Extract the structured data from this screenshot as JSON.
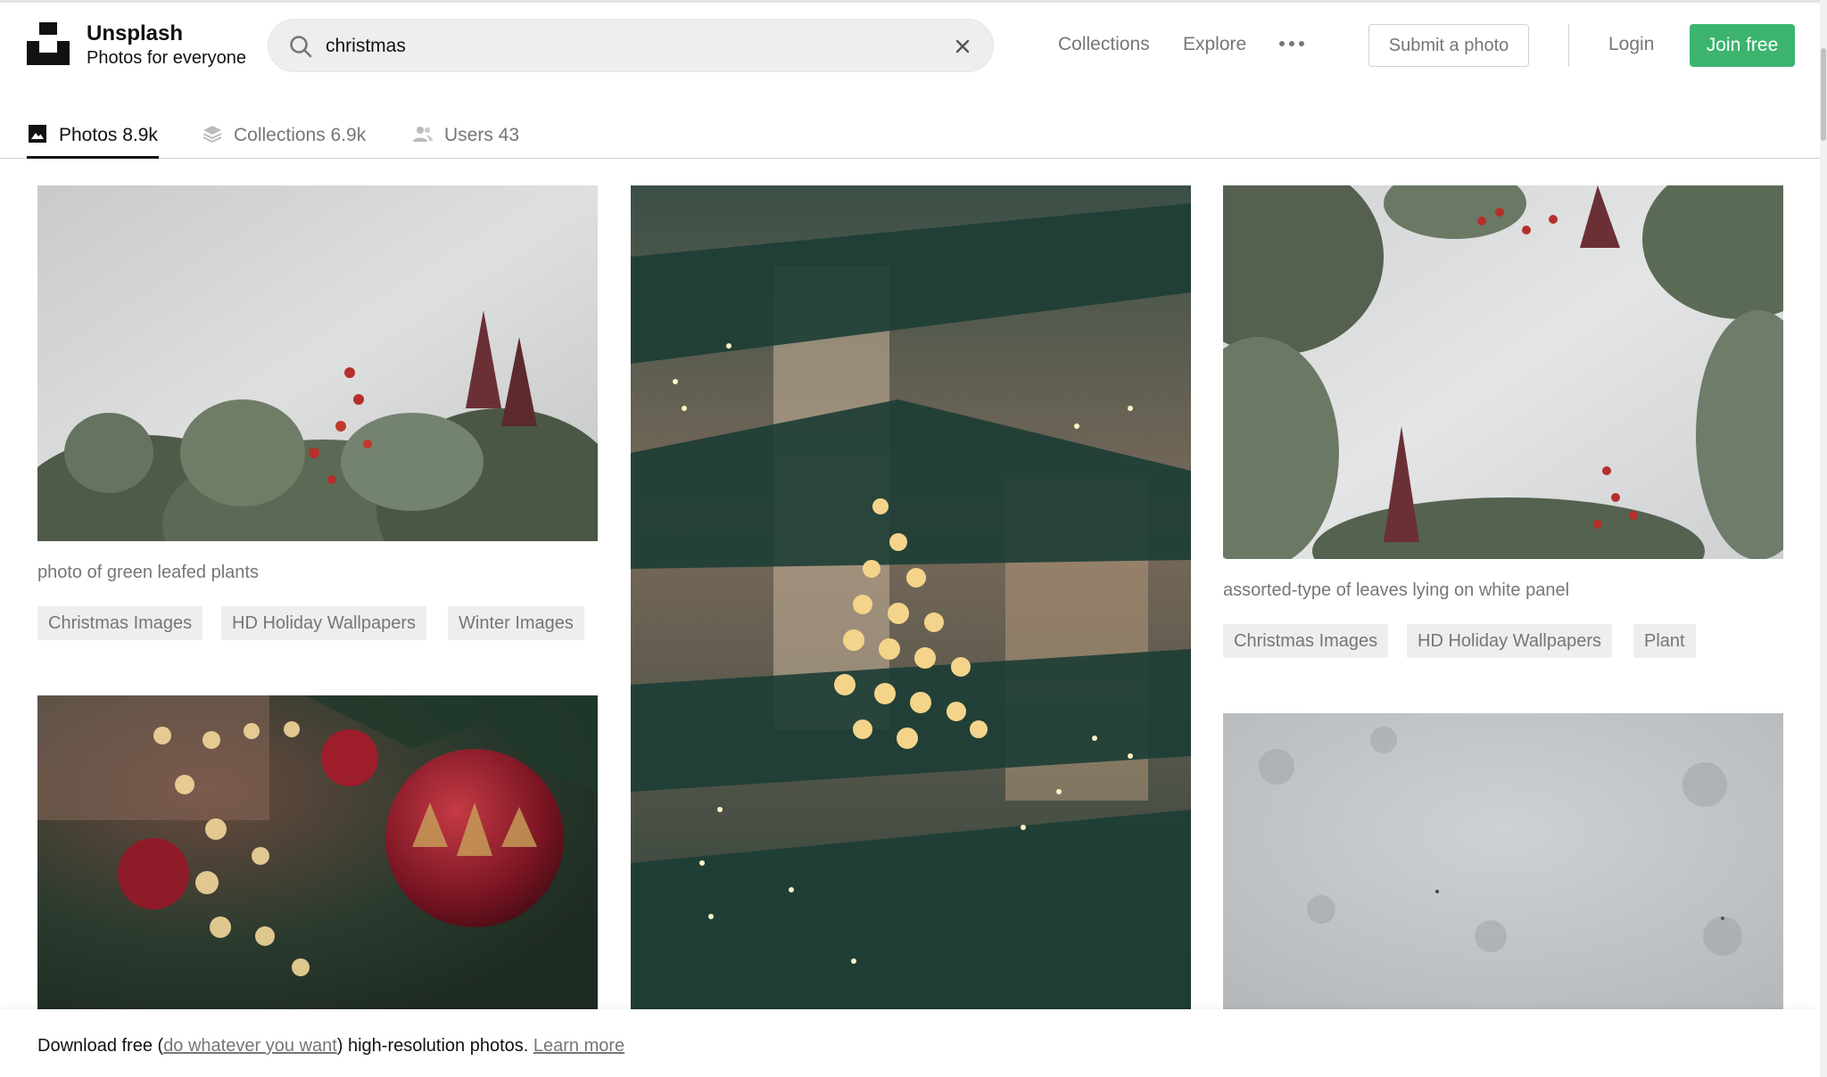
{
  "brand": {
    "name": "Unsplash",
    "tagline": "Photos for everyone"
  },
  "search": {
    "value": "christmas",
    "placeholder": "Search free high-resolution photos",
    "icon": "search-icon",
    "clear_icon": "close-icon"
  },
  "nav": {
    "collections": "Collections",
    "explore": "Explore",
    "more_icon": "more-horizontal-icon",
    "submit": "Submit a photo",
    "login": "Login",
    "join": "Join free"
  },
  "tabs": [
    {
      "label": "Photos 8.9k",
      "icon": "image-icon",
      "active": true
    },
    {
      "label": "Collections 6.9k",
      "icon": "layers-icon",
      "active": false
    },
    {
      "label": "Users 43",
      "icon": "users-icon",
      "active": false
    }
  ],
  "photos": [
    {
      "caption": "photo of green leafed plants",
      "tags": [
        "Christmas Images",
        "HD Holiday Wallpapers",
        "Winter Images"
      ]
    },
    {
      "caption": "",
      "tags": []
    },
    {
      "caption": "assorted-type of leaves lying on white panel",
      "tags": [
        "Christmas Images",
        "HD Holiday Wallpapers",
        "Plant"
      ]
    }
  ],
  "banner": {
    "prefix": "Download free (",
    "link1": "do whatever you want",
    "middle": ") high-resolution photos. ",
    "link2": "Learn more"
  },
  "colors": {
    "accent": "#3cb46e",
    "muted": "#767676",
    "tag_bg": "#eeeeee"
  }
}
